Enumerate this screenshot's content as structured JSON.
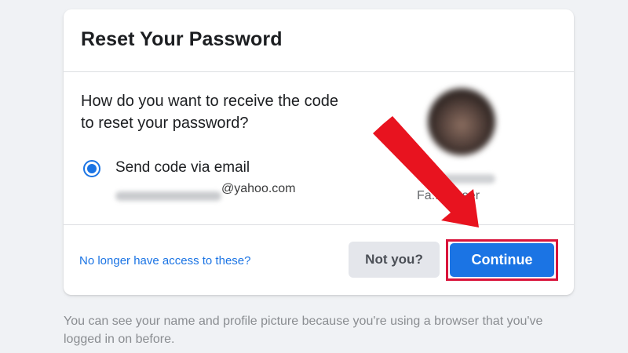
{
  "dialog": {
    "title": "Reset Your Password",
    "question": "How do you want to receive the code to reset your password?",
    "option": {
      "label": "Send code via email",
      "email_domain": "@yahoo.com",
      "selected": true
    },
    "profile": {
      "subtitle": "Fa... k user"
    },
    "footer": {
      "link_label": "No longer have access to these?",
      "not_you_label": "Not you?",
      "continue_label": "Continue"
    }
  },
  "footnote": "You can see your name and profile picture because you're using a browser that you've logged in on before.",
  "colors": {
    "accent": "#1b74e4",
    "highlight_border": "#d9143b",
    "arrow": "#e8131f",
    "background": "#f0f2f5"
  }
}
